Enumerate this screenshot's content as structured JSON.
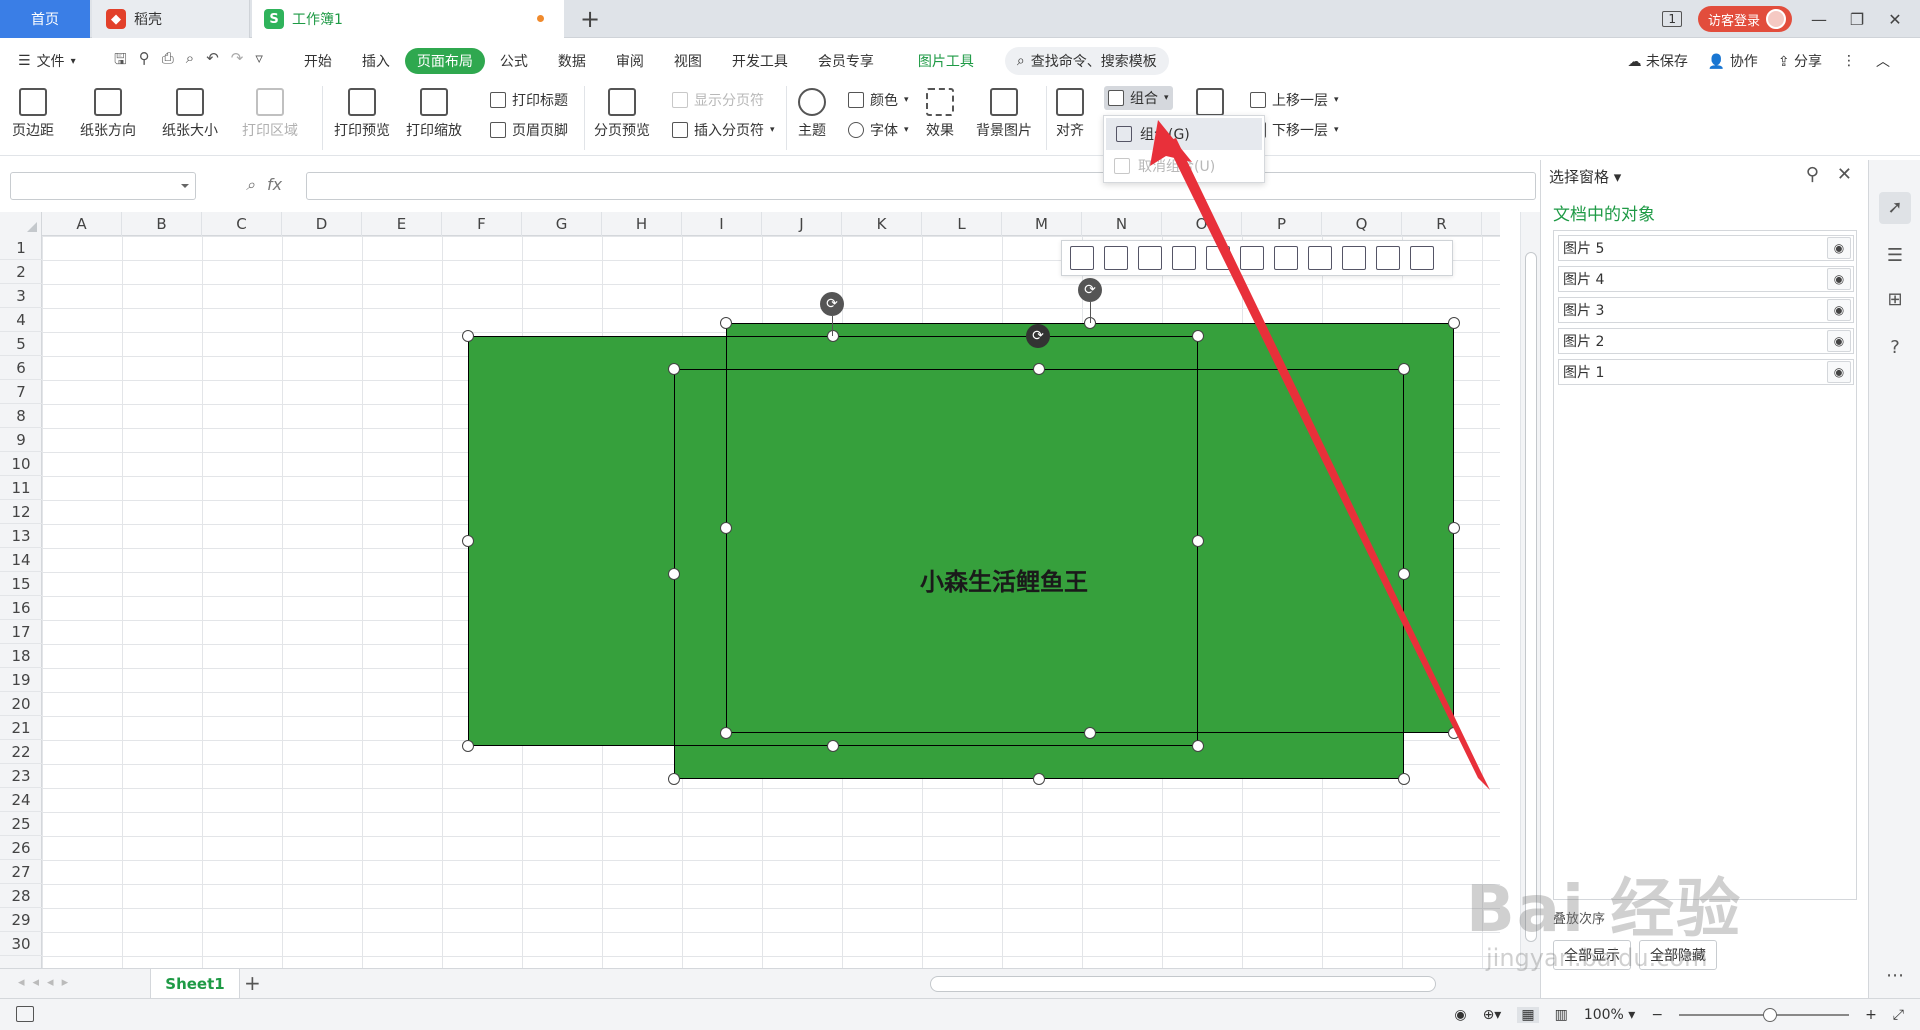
{
  "tabs": {
    "home": "首页",
    "daoke": "稻壳",
    "workbook": "工作簿1",
    "add": "+"
  },
  "window": {
    "page_indicator": "1",
    "login": "访客登录",
    "minimize": "—",
    "restore": "❐",
    "close": "✕"
  },
  "menu": {
    "file": "文件",
    "tabs": [
      "开始",
      "插入",
      "页面布局",
      "公式",
      "数据",
      "审阅",
      "视图",
      "开发工具",
      "会员专享",
      "图片工具"
    ],
    "search": "查找命令、搜索模板",
    "unsaved": "未保存",
    "collab": "协作",
    "share": "分享"
  },
  "ribbon": {
    "margin": "页边距",
    "orientation": "纸张方向",
    "size": "纸张大小",
    "print_area": "打印区域",
    "print_preview": "打印预览",
    "print_scale": "打印缩放",
    "print_title": "打印标题",
    "header_footer": "页眉页脚",
    "page_break_preview": "分页预览",
    "show_page_break": "显示分页符",
    "insert_page_break": "插入分页符",
    "theme": "主题",
    "color": "颜色",
    "font": "字体",
    "effect": "效果",
    "bg_image": "背景图片",
    "align": "对齐",
    "group": "组合",
    "up_layer": "上移一层",
    "down_layer": "下移一层"
  },
  "dropdown": {
    "group": "组合(G)",
    "ungroup": "取消组合(U)"
  },
  "formula": {
    "fx": "fx"
  },
  "columns": [
    "A",
    "B",
    "C",
    "D",
    "E",
    "F",
    "G",
    "H",
    "I",
    "J",
    "K",
    "L",
    "M",
    "N",
    "O",
    "P",
    "Q",
    "R"
  ],
  "rows": [
    "1",
    "2",
    "3",
    "4",
    "5",
    "6",
    "7",
    "8",
    "9",
    "10",
    "11",
    "12",
    "13",
    "14",
    "15",
    "16",
    "17",
    "18",
    "19",
    "20",
    "21",
    "22",
    "23",
    "24",
    "25",
    "26",
    "27",
    "28",
    "29",
    "30"
  ],
  "shape_text": "小森生活鲤鱼王",
  "sheet": {
    "name": "Sheet1",
    "add": "+"
  },
  "status": {
    "zoom": "100%",
    "minus": "−",
    "plus": "+"
  },
  "pane": {
    "title": "选择窗格",
    "subtitle": "文档中的对象",
    "items": [
      "图片 5",
      "图片 4",
      "图片 3",
      "图片 2",
      "图片 1"
    ],
    "order": "叠放次序",
    "show_all": "全部显示",
    "hide_all": "全部隐藏"
  },
  "watermark": {
    "main": "Bai 经验",
    "sub": "jingyan.baidu.com"
  },
  "colors": {
    "shape_green": "#36a03c",
    "accent_green": "#2fa84f",
    "arrow_red": "#e8303a",
    "home_tab_blue": "#3a7ee6"
  }
}
